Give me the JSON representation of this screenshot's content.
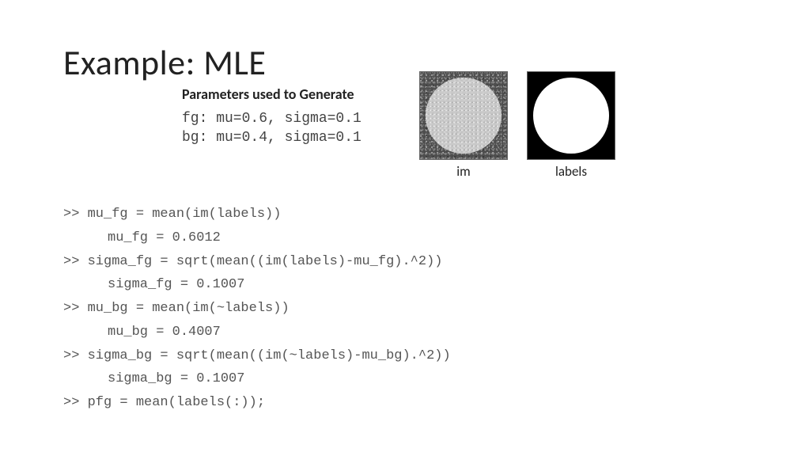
{
  "title": "Example: MLE",
  "params": {
    "heading": "Parameters used to Generate",
    "line1": "fg: mu=0.6, sigma=0.1",
    "line2": "bg: mu=0.4, sigma=0.1"
  },
  "images": {
    "im_caption": "im",
    "labels_caption": "labels"
  },
  "code": {
    "l1": ">> mu_fg = mean(im(labels))",
    "l2": "mu_fg = 0.6012",
    "l3": ">> sigma_fg = sqrt(mean((im(labels)-mu_fg).^2))",
    "l4": "sigma_fg = 0.1007",
    "l5": ">> mu_bg = mean(im(~labels))",
    "l6": "mu_bg = 0.4007",
    "l7": ">> sigma_bg = sqrt(mean((im(~labels)-mu_bg).^2))",
    "l8": "sigma_bg = 0.1007",
    "l9": ">> pfg = mean(labels(:));"
  }
}
